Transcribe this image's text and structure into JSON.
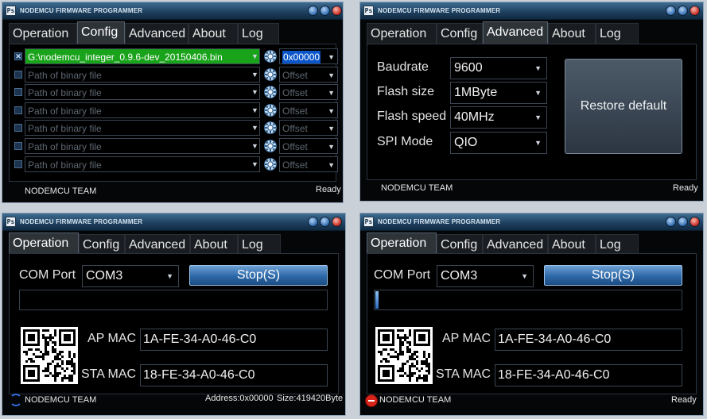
{
  "app_title": "NODEMCU FIRMWARE PROGRAMMER",
  "icon_glyph": "Ps",
  "tabs": [
    "Operation",
    "Config",
    "Advanced",
    "About",
    "Log"
  ],
  "footer_team": "NODEMCU TEAM",
  "status_ready": "Ready",
  "config": {
    "rows": [
      {
        "checked": true,
        "path": "G:\\nodemcu_integer_0.9.6-dev_20150406.bin",
        "offset": "0x00000"
      },
      {
        "checked": false,
        "path": "",
        "offset": ""
      },
      {
        "checked": false,
        "path": "",
        "offset": ""
      },
      {
        "checked": false,
        "path": "",
        "offset": ""
      },
      {
        "checked": false,
        "path": "",
        "offset": ""
      },
      {
        "checked": false,
        "path": "",
        "offset": ""
      },
      {
        "checked": false,
        "path": "",
        "offset": ""
      }
    ],
    "path_placeholder": "Path of binary file",
    "offset_placeholder": "Offset",
    "check_mark": "✕"
  },
  "advanced": {
    "fields": [
      {
        "label": "Baudrate",
        "value": "9600"
      },
      {
        "label": "Flash size",
        "value": "1MByte"
      },
      {
        "label": "Flash speed",
        "value": "40MHz"
      },
      {
        "label": "SPI Mode",
        "value": "QIO"
      }
    ],
    "restore_label": "Restore default"
  },
  "operation_left": {
    "com_label": "COM Port",
    "com_value": "COM3",
    "stop_label": "Stop(S)",
    "progress": 0,
    "ap_mac_label": "AP MAC",
    "ap_mac": "1A-FE-34-A0-46-C0",
    "sta_mac_label": "STA MAC",
    "sta_mac": "18-FE-34-A0-46-C0",
    "address": "Address:0x00000",
    "size": "Size:419420Byte"
  },
  "operation_right": {
    "com_label": "COM Port",
    "com_value": "COM3",
    "stop_label": "Stop(S)",
    "progress": 0.01,
    "ap_mac_label": "AP MAC",
    "ap_mac": "1A-FE-34-A0-46-C0",
    "sta_mac_label": "STA MAC",
    "sta_mac": "18-FE-34-A0-46-C0",
    "status": "Ready"
  },
  "dropdown_glyph": "▼",
  "colors": {
    "accent": "#2d68a8",
    "filled": "#19a31a",
    "error": "#d8241a"
  },
  "icons": [
    "gear-icon",
    "minimize-icon",
    "maximize-icon",
    "close-icon",
    "sync-icon",
    "stop-icon",
    "qr-code-image",
    "app-icon"
  ]
}
